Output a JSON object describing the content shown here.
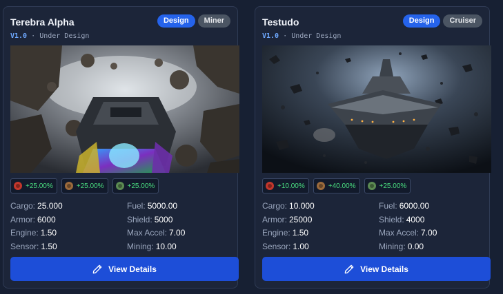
{
  "ships": [
    {
      "name": "Terebra Alpha",
      "tags": [
        "Design",
        "Miner"
      ],
      "version": "V1.0",
      "separator": "·",
      "status": "Under Design",
      "image_icon": "miner-ship-in-asteroid-field-image",
      "bonuses": [
        {
          "icon": "red-icon",
          "color": "#c2372c",
          "value": "+25.00%"
        },
        {
          "icon": "orange-icon",
          "color": "#9b6a3c",
          "value": "+25.00%"
        },
        {
          "icon": "green-icon",
          "color": "#5b8a52",
          "value": "+25.00%"
        }
      ],
      "attributes": [
        {
          "label": "Cargo:",
          "value": "25.000"
        },
        {
          "label": "Fuel:",
          "value": "5000.00"
        },
        {
          "label": "Armor:",
          "value": "6000"
        },
        {
          "label": "Shield:",
          "value": "5000"
        },
        {
          "label": "Engine:",
          "value": "1.50"
        },
        {
          "label": "Max Accel:",
          "value": "7.00"
        },
        {
          "label": "Sensor:",
          "value": "1.50"
        },
        {
          "label": "Mining:",
          "value": "10.00"
        }
      ],
      "button_label": "View Details",
      "button_icon": "pencil-icon"
    },
    {
      "name": "Testudo",
      "tags": [
        "Design",
        "Cruiser"
      ],
      "version": "V1.0",
      "separator": "·",
      "status": "Under Design",
      "image_icon": "cruiser-ship-in-debris-field-image",
      "bonuses": [
        {
          "icon": "red-icon",
          "color": "#c2372c",
          "value": "+10.00%"
        },
        {
          "icon": "orange-icon",
          "color": "#9b6a3c",
          "value": "+40.00%"
        },
        {
          "icon": "green-icon",
          "color": "#5b8a52",
          "value": "+25.00%"
        }
      ],
      "attributes": [
        {
          "label": "Cargo:",
          "value": "10.000"
        },
        {
          "label": "Fuel:",
          "value": "6000.00"
        },
        {
          "label": "Armor:",
          "value": "25000"
        },
        {
          "label": "Shield:",
          "value": "4000"
        },
        {
          "label": "Engine:",
          "value": "1.50"
        },
        {
          "label": "Max Accel:",
          "value": "7.00"
        },
        {
          "label": "Sensor:",
          "value": "1.00"
        },
        {
          "label": "Mining:",
          "value": "0.00"
        }
      ],
      "button_label": "View Details",
      "button_icon": "pencil-icon"
    }
  ],
  "colors": {
    "background": "#172033",
    "card": "#1c2539",
    "primary": "#2563eb",
    "bonus_text": "#4ade80"
  }
}
